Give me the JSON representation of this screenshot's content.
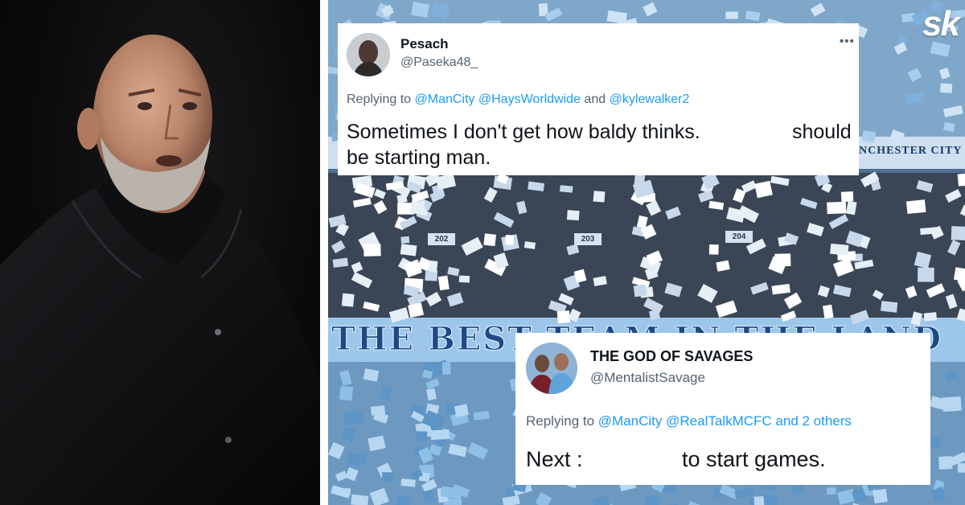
{
  "logo": {
    "text": "sk"
  },
  "stadium": {
    "banner_text": "THE BEST TEAM IN THE LAND",
    "sign_text": "NCHESTER CITY",
    "seat_numbers": [
      "202",
      "203",
      "204"
    ]
  },
  "tweets": [
    {
      "name": "Pesach",
      "handle": "@Paseka48_",
      "more_icon": "more-horizontal-icon",
      "replying_prefix": "Replying to ",
      "mentions": [
        "@ManCity",
        "@HaysWorldwide"
      ],
      "joiner": "and",
      "last_mention": "@kylewalker2",
      "body_line1": "Sometimes I don't get how baldy thinks.",
      "body_line1_end": "should",
      "body_line2": "be starting man."
    },
    {
      "name": "THE GOD OF SAVAGES",
      "handle": "@MentalistSavage",
      "replying_prefix": "Replying to ",
      "mentions": [
        "@ManCity",
        "@RealTalkMCFC"
      ],
      "joiner": "and 2 others",
      "body_start": "Next :",
      "body_end": "to start games."
    }
  ],
  "colors": {
    "mention": "#1d9bf0",
    "secondary_text": "#536471",
    "primary_text": "#0f1419",
    "stadium_sky_blue": "#98c5e9",
    "banner_navy": "#1d4a86"
  }
}
